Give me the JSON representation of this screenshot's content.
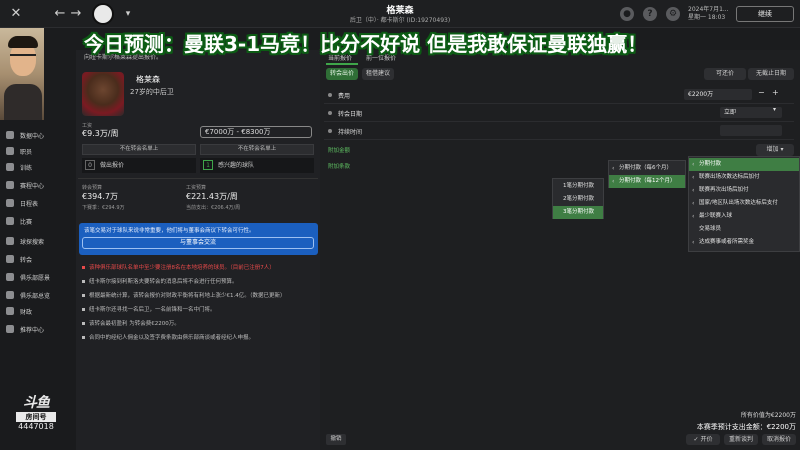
{
  "overlay": {
    "title": "今日预测：曼联3-1马竞！比分不好说 但是我敢保证曼联独赢！"
  },
  "header": {
    "player_name": "格莱森",
    "subtitle": "后卫（中）· 都卡斯尔 (ID:19270493)",
    "date": "2024年7月1...",
    "time": "星期一 18:03",
    "continue_label": "继续",
    "icons": [
      "close-icon",
      "back-icon",
      "forward-icon",
      "search-icon",
      "settings-icon",
      "help-icon"
    ]
  },
  "player": {
    "name": "格莱森",
    "position": "27岁的中后卫",
    "top_line": "向纽卡斯尔格莱森提出报价。",
    "wage_label": "工资",
    "wage_value": "€9.3万/周",
    "wage_range": "€7000万 - €8300万",
    "not_listed_label_1": "不在转会名单上",
    "not_listed_label_2": "不在转会名单上",
    "bids_count": "0",
    "bids_label": "做出报价",
    "interested_count": "1",
    "interested_label": "感兴趣的球队",
    "transfer_budget_label": "转会预算",
    "transfer_budget_value": "€394.7万",
    "transfer_budget_sub": "下赛季：€294.9万",
    "wage_budget_label": "工资预算",
    "wage_budget_value": "€221.43万/周",
    "wage_budget_sub": "当前支出：€206.4万/周"
  },
  "note": {
    "text": "该笔交易对于球队来说非常重要，他们将与董事会商议下转会可行性。",
    "button_label": "与董事会交流"
  },
  "bullets": [
    {
      "text": "该种俱乐部球队名单中至少要注册8名在本地培养的球员。（目前已注册7人）",
      "red": true
    },
    {
      "text": "纽卡斯尔接到利斯洛夫要转会的消息后将不会进行任何预算。",
      "red": false
    },
    {
      "text": "根据最新统计算，该转会报价对财政平衡将有利地上涨少€1.4亿。（数据已更新）",
      "red": false
    },
    {
      "text": "纽卡斯尔还寻找一名后卫，一名前锋和一名中门将。",
      "red": false
    },
    {
      "text": "该转会最初盈利 为转会费€2200万。",
      "red": false
    },
    {
      "text": "合同中的经纪人佣金以及签字费条款由俱乐部商谈或者经纪人申报。",
      "red": false
    }
  ],
  "offer": {
    "tabs": [
      "当前报价",
      "前一位报价"
    ],
    "type_buttons": [
      "转会出价",
      "租借建议"
    ],
    "right_buttons": [
      "可还价",
      "无截止日期"
    ],
    "rows": {
      "fee_label": "费用",
      "fee_value": "€2200万",
      "date_label": "转会日期",
      "date_value": "立即",
      "duration_label": "持续时间"
    },
    "add_fee_label": "附加金额",
    "add_clause_label": "附加条款",
    "add_button": "增加",
    "installment_menu": [
      "分期付款（每6个月）",
      "分期付款（每12个月）"
    ],
    "count_menu": [
      "1笔分期付款",
      "2笔分期付款",
      "3笔分期付款"
    ],
    "clause_menu": [
      "分期付款",
      "联赛出场次数达标后加付",
      "联赛再次出场后加付",
      "国家/地区队出场次数达标后支付",
      "最少联赛入球",
      "交易球员",
      "达成赛事或者所需奖金"
    ],
    "bottom_value_label": "所有价值为€2200万",
    "bottom_total_label": "本赛季预计支出金额：€2200万",
    "bottom_buttons": [
      "开价",
      "重新谈判",
      "取消报价"
    ],
    "cancel_small": "撤销"
  },
  "nav": [
    "数据中心",
    "职员",
    "训练",
    "赛程中心",
    "日程表",
    "比赛",
    "球探搜索",
    "转会",
    "俱乐部愿景",
    "俱乐部总览",
    "财政",
    "推荐中心"
  ],
  "stream": {
    "logo_text": "斗鱼",
    "badge": "房间号",
    "room_number": "4447018"
  }
}
